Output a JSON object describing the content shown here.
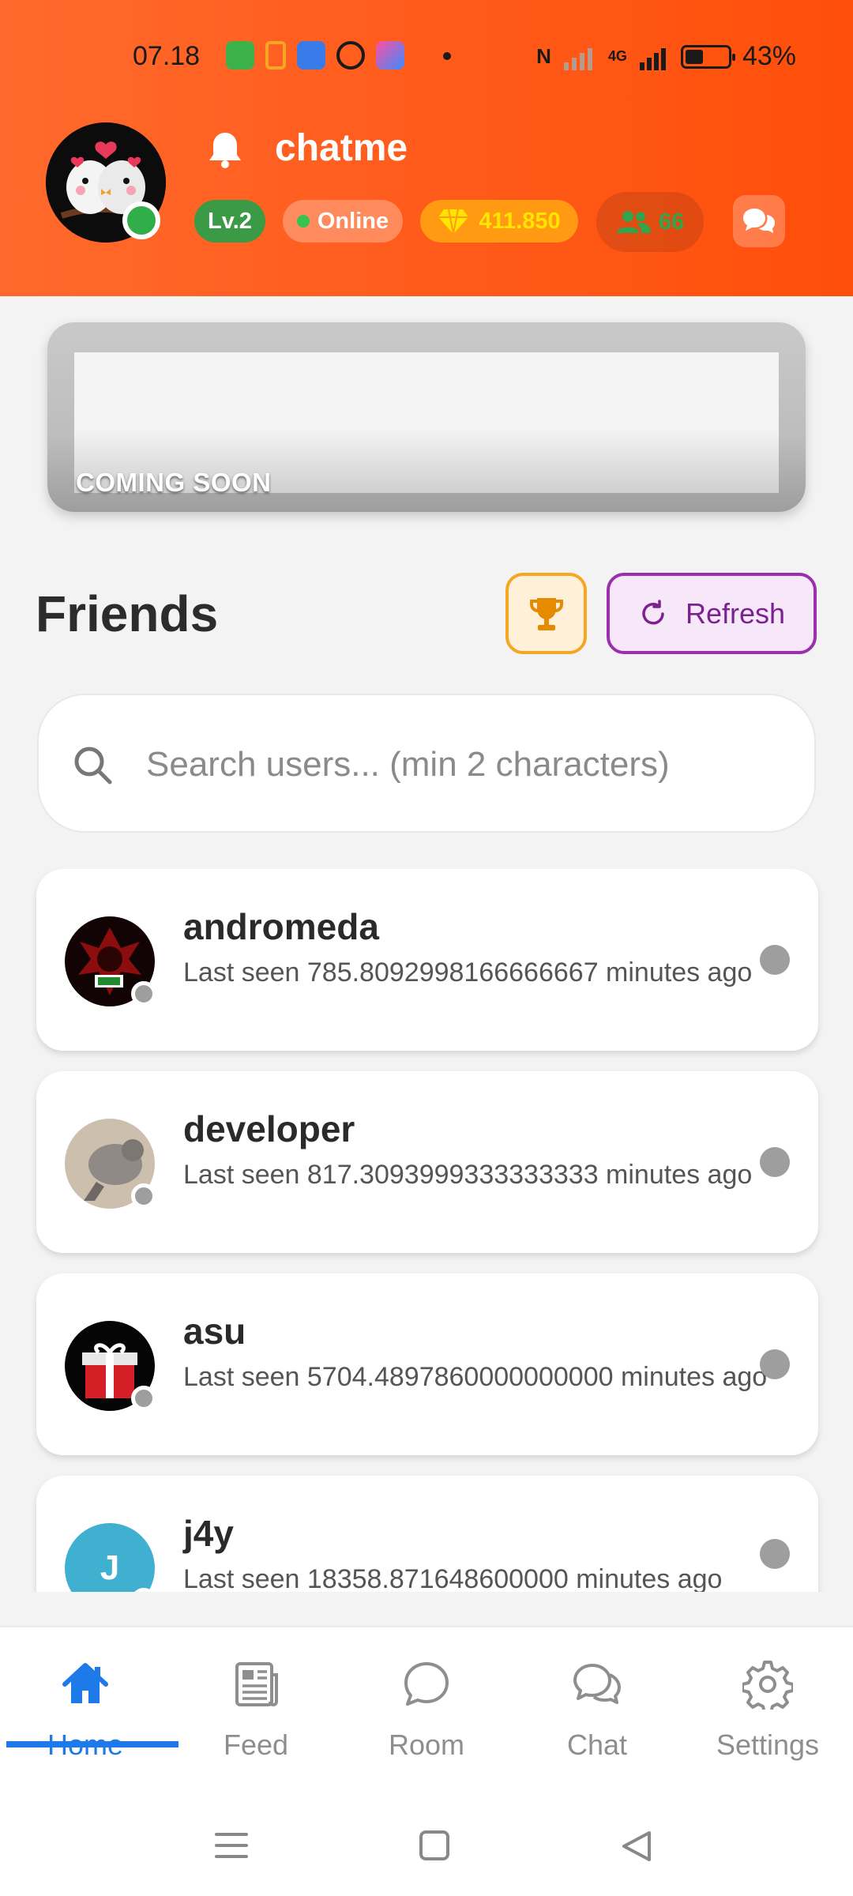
{
  "status_bar": {
    "time": "07.18",
    "battery": "43%",
    "battery_fraction": 0.43,
    "network": "4G"
  },
  "profile": {
    "username": "chatme",
    "level": "Lv.2",
    "presence": "Online",
    "gems": "411.850",
    "friends_count": "66"
  },
  "banner": {
    "label": "COMING SOON"
  },
  "friends": {
    "title": "Friends",
    "refresh_label": "Refresh",
    "search_placeholder": "Search users... (min 2 characters)",
    "items": [
      {
        "name": "andromeda",
        "last_seen": "Last seen 785.8092998166666667 minutes ago"
      },
      {
        "name": "developer",
        "last_seen": "Last seen 817.3093999333333333 minutes ago"
      },
      {
        "name": "asu",
        "last_seen": "Last seen 5704.4897860000000000 minutes ago"
      },
      {
        "name": "j4y",
        "avatar_letter": "J",
        "last_seen": "Last seen 18358.871648600000 minutes ago"
      }
    ]
  },
  "nav": {
    "items": [
      {
        "label": "Home",
        "icon": "home-icon",
        "active": true
      },
      {
        "label": "Feed",
        "icon": "newspaper-icon"
      },
      {
        "label": "Room",
        "icon": "speech-bubble-icon"
      },
      {
        "label": "Chat",
        "icon": "chat-bubbles-icon"
      },
      {
        "label": "Settings",
        "icon": "gear-icon"
      }
    ]
  },
  "colors": {
    "header": "#ff5a1a",
    "accent": "#1e7ae8",
    "level_badge": "#3a9a45",
    "gem_chip": "#ff9a12",
    "refresh_border": "#9b2fae",
    "trophy_border": "#f5a623",
    "offline_dot": "#9e9e9e",
    "online_dot": "#2fae4a"
  }
}
